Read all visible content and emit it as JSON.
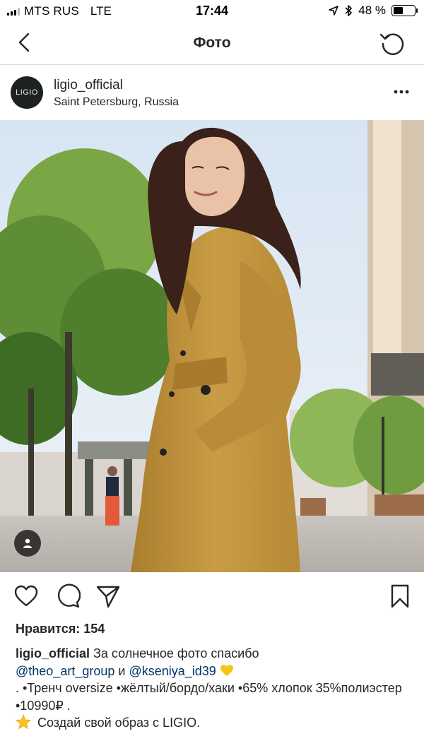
{
  "status_bar": {
    "carrier": "MTS RUS",
    "network": "LTE",
    "time": "17:44",
    "battery_percent": "48 %",
    "battery_level": 0.48
  },
  "nav": {
    "title": "Фото"
  },
  "post": {
    "username": "ligio_official",
    "location": "Saint Petersburg, Russia",
    "avatar_text": "LIGIO"
  },
  "likes": "Нравится: 154",
  "caption": {
    "username": "ligio_official",
    "text_1": " За солнечное фото спасибо",
    "mention_1": "@theo_art_group",
    "and": " и ",
    "mention_2": "@kseniya_id39",
    "line_2": ". •Тренч oversize •жёлтый/бордо/хаки •65% хлопок 35%полиэстер",
    "line_3": "•10990₽ .",
    "line_4": " Создай свой образ с  LIGIO."
  },
  "icons": {
    "back": "chevron-left-icon",
    "refresh": "refresh-icon",
    "more": "more-horizontal-icon",
    "like": "heart-icon",
    "comment": "comment-icon",
    "share": "paper-plane-icon",
    "save": "bookmark-icon",
    "tag": "person-icon"
  },
  "colors": {
    "mention": "#003569",
    "coat": "#c7993f",
    "text": "#262626"
  }
}
